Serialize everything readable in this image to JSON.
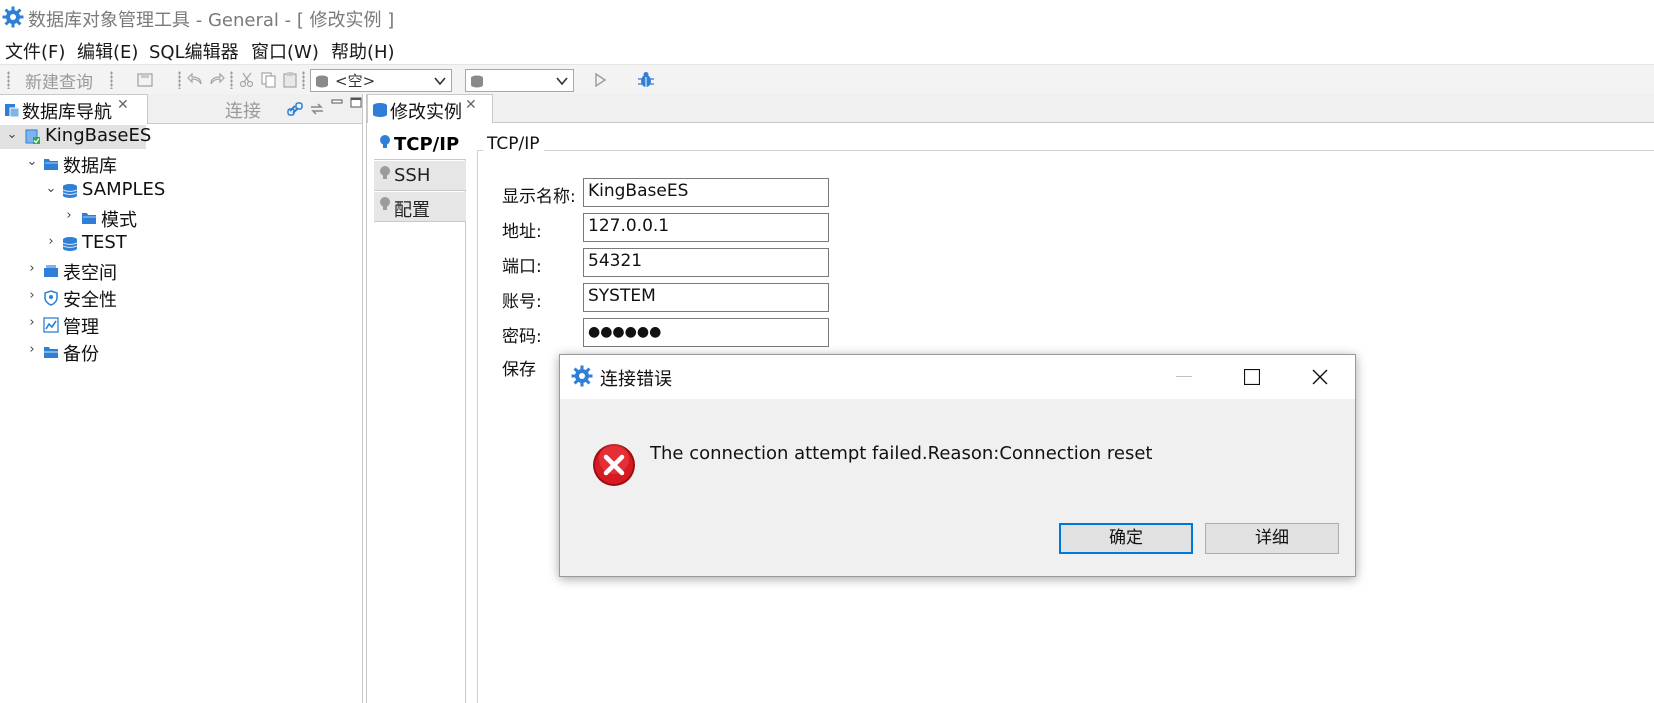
{
  "window": {
    "title": "数据库对象管理工具 - General - [ 修改实例 ]"
  },
  "menu": [
    {
      "label": "文件(F)"
    },
    {
      "label": "编辑(E)"
    },
    {
      "label": "SQL编辑器"
    },
    {
      "label": "窗口(W)"
    },
    {
      "label": "帮助(H)"
    }
  ],
  "toolbar": {
    "new_query": "新建查询",
    "connection_combo": "<空>",
    "database_combo": ""
  },
  "navigator": {
    "tab_label": "数据库导航",
    "connect_label": "连接",
    "tree": [
      {
        "label": "KingBaseES",
        "icon": "server-icon",
        "expanded": true,
        "selected": true
      },
      {
        "label": "数据库",
        "icon": "folder-icon",
        "expanded": true
      },
      {
        "label": "SAMPLES",
        "icon": "database-icon",
        "expanded": true
      },
      {
        "label": "模式",
        "icon": "folder-icon",
        "expanded": false
      },
      {
        "label": "TEST",
        "icon": "database-icon",
        "expanded": false
      },
      {
        "label": "表空间",
        "icon": "tablespace-icon",
        "expanded": false
      },
      {
        "label": "安全性",
        "icon": "shield-icon",
        "expanded": false
      },
      {
        "label": "管理",
        "icon": "management-icon",
        "expanded": false
      },
      {
        "label": "备份",
        "icon": "backup-icon",
        "expanded": false
      }
    ]
  },
  "editor": {
    "tab_label": "修改实例",
    "side_tabs": [
      {
        "label": "TCP/IP",
        "active": true
      },
      {
        "label": "SSH",
        "active": false
      },
      {
        "label": "配置",
        "active": false
      }
    ],
    "group_title": "TCP/IP",
    "fields": {
      "display_name": {
        "label": "显示名称:",
        "value": "KingBaseES"
      },
      "address": {
        "label": "地址:",
        "value": "127.0.0.1"
      },
      "port": {
        "label": "端口:",
        "value": "54321"
      },
      "account": {
        "label": "账号:",
        "value": "SYSTEM"
      },
      "password": {
        "label": "密码:",
        "value": "●●●●●●"
      },
      "save_partial": "保存"
    }
  },
  "dialog": {
    "title": "连接错误",
    "message": "The connection attempt failed.Reason:Connection reset",
    "ok_label": "确定",
    "details_label": "详细",
    "icon": "error-icon"
  },
  "colors": {
    "accent_blue": "#2f7fd6",
    "error_red": "#c8141c",
    "default_button_border": "#0078d7"
  }
}
